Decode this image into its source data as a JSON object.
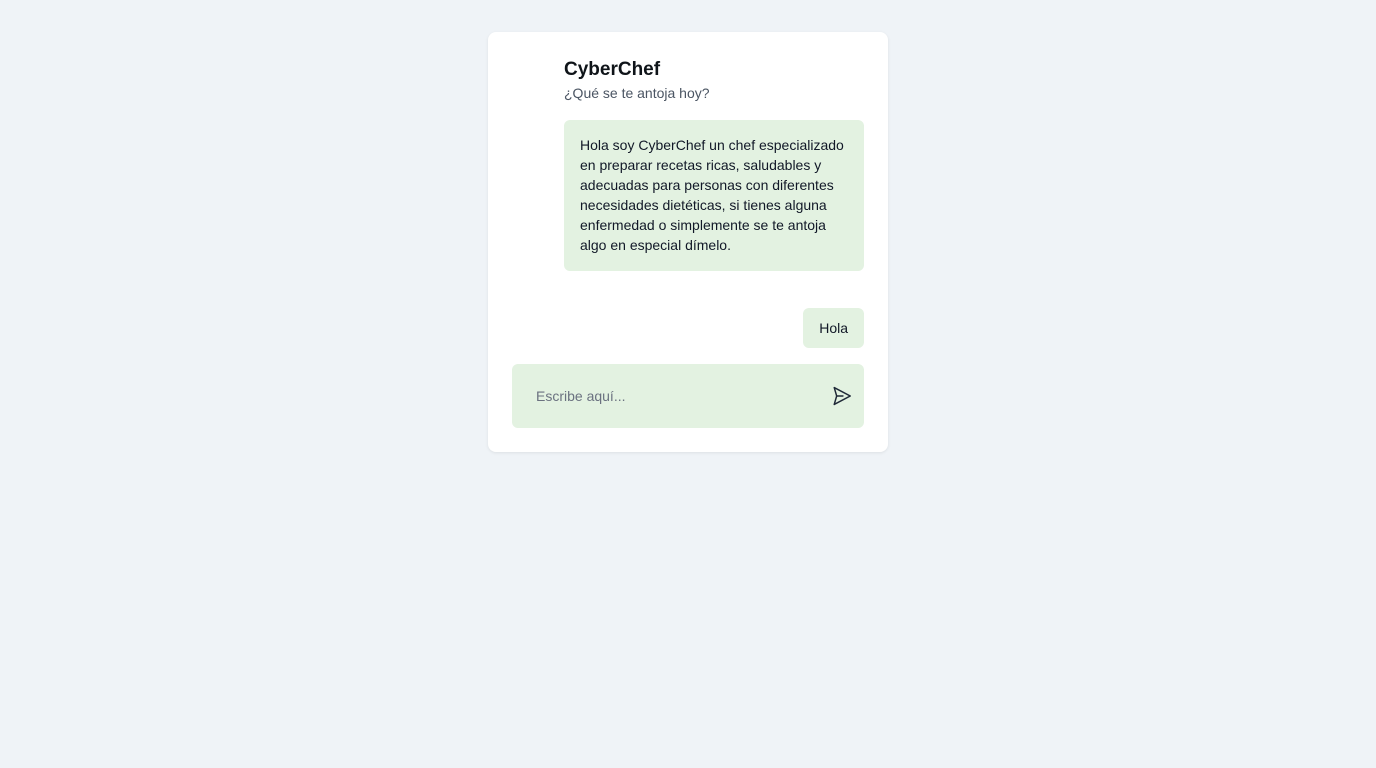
{
  "chat": {
    "title": "CyberChef",
    "subtitle": "¿Qué se te antoja hoy?",
    "messages": [
      {
        "role": "bot",
        "text": "Hola soy CyberChef un chef especializado en preparar recetas ricas, saludables y adecuadas para personas con diferentes necesidades dietéticas, si tienes alguna enfermedad o simplemente se te antoja algo en especial dímelo."
      },
      {
        "role": "user",
        "text": "Hola"
      }
    ]
  },
  "composer": {
    "placeholder": "Escribe aquí...",
    "value": "",
    "send_icon": "send-icon"
  },
  "colors": {
    "page_background": "#eff3f7",
    "card_background": "#ffffff",
    "bubble_background": "#e3f2e1",
    "text": "#111827",
    "subtitle": "#4b5563"
  }
}
